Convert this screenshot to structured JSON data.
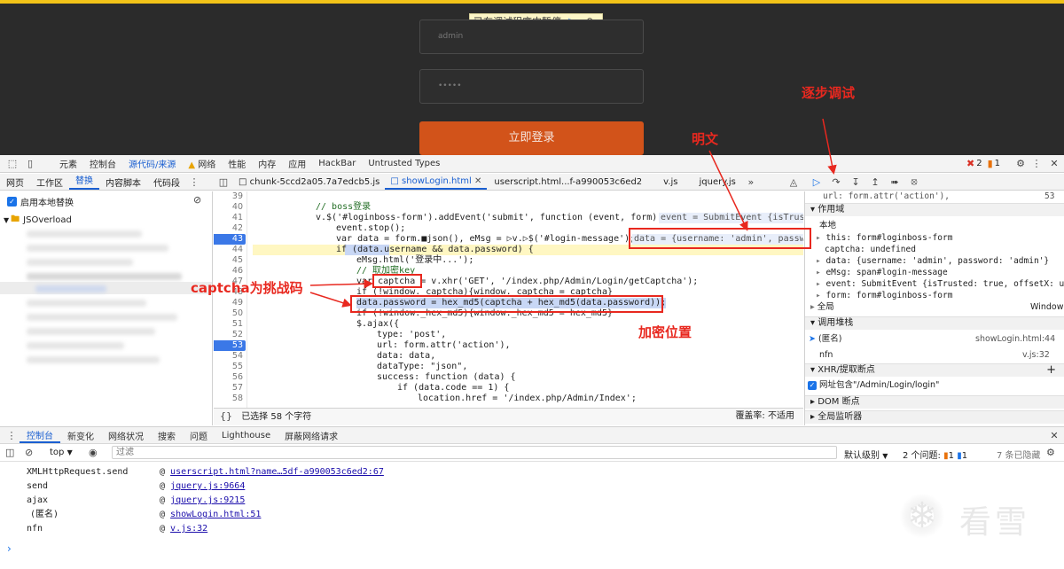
{
  "page": {
    "paused_banner": "已在调试程序中暂停",
    "username_value": "admin",
    "password_value": "•••••",
    "login_button": "立即登录"
  },
  "devtools": {
    "main_tabs": [
      "元素",
      "控制台",
      "源代码/来源",
      "网络",
      "性能",
      "内存",
      "应用",
      "HackBar",
      "Untrusted Types"
    ],
    "errors": "2",
    "warnings": "1",
    "nav_tabs": [
      "网页",
      "工作区",
      "替换",
      "内容脚本",
      "代码段"
    ],
    "file_tabs": [
      "chunk-5ccd2a05.7a7edcb5.js",
      "showLogin.html",
      "userscript.html...f-a990053c6ed2",
      "v.js",
      "jquery.js"
    ],
    "local_override_label": "启用本地替换",
    "folder_name": "JSOverload",
    "status_selected": "已选择 58 个字符",
    "status_coverage": "覆盖率: 不适用",
    "code": {
      "line_numbers": [
        "39",
        "40",
        "41",
        "42",
        "43",
        "44",
        "45",
        "46",
        "47",
        "48",
        "49",
        "50",
        "51",
        "52",
        "53",
        "54",
        "55",
        "56",
        "57",
        "58"
      ],
      "l40": "// boss登录",
      "l41a": "v.$('#loginboss-form').addEvent('submit', function (event, form) {",
      "l41b": "event = SubmitEvent {isTrust",
      "l42": "event.stop();",
      "l43": "var data = form.■json(), eMsg = ▷v.▷$('#login-message');",
      "l43b": "data = {username: 'admin', passwo",
      "l44": "if (data.username && data.password) {",
      "l45": "eMsg.html('登录中...');",
      "l46": "// 取加密key",
      "l47": "var captcha = v.xhr('GET', '/index.php/Admin/Login/getCaptcha');",
      "l48": "if (!window._captcha){window._captcha = captcha}",
      "l49": "data.password = hex_md5(captcha + hex_md5(data.password));",
      "l50": "if (!window._hex_md5){window._hex_md5 = hex_md5}",
      "l51": "$.ajax({",
      "l52": "type: 'post',",
      "l53": "url: form.attr('action'),",
      "l54": "data: data,",
      "l55": "dataType: \"json\",",
      "l56": "success: function (data) {",
      "l57": "if (data.code == 1) {",
      "l58": "location.href = '/index.php/Admin/Index';"
    },
    "right": {
      "top_line": "url: form.attr('action'),",
      "top_line_num": "53",
      "scope_header": "作用域",
      "local_header": "本地",
      "scope_items": [
        "this: form#loginboss-form",
        "captcha: undefined",
        "data: {username: 'admin', password: 'admin'}",
        "eMsg: span#login-message",
        "event: SubmitEvent {isTrusted: true, offsetX: u",
        "form: form#loginboss-form"
      ],
      "global_label": "全局",
      "global_value": "Window",
      "callstack_header": "调用堆栈",
      "callstack": [
        {
          "name": "(匿名)",
          "loc": "showLogin.html:44"
        },
        {
          "name": "nfn",
          "loc": "v.js:32"
        }
      ],
      "xhr_header": "XHR/提取断点",
      "xhr_item": "网址包含\"/Admin/Login/login\"",
      "dom_header": "DOM 断点",
      "global_listeners": "全局监听器"
    },
    "console_tabs": [
      "控制台",
      "新变化",
      "网络状况",
      "搜索",
      "问题",
      "Lighthouse",
      "屏蔽网络请求"
    ],
    "console_bar": {
      "context": "top",
      "filter_placeholder": "过滤",
      "level": "默认级别",
      "issues_label": "2 个问题:",
      "issue_warn": "1",
      "issue_info": "1",
      "hidden": "7 条已隐藏"
    },
    "console_logs": [
      {
        "fn": "XMLHttpRequest.send",
        "src": "userscript.html?name…5df-a990053c6ed2:67"
      },
      {
        "fn": "send",
        "src": "jquery.js:9664"
      },
      {
        "fn": "ajax",
        "src": "jquery.js:9215"
      },
      {
        "fn": "(匿名)",
        "src": "showLogin.html:51"
      },
      {
        "fn": "nfn",
        "src": "v.js:32"
      }
    ]
  },
  "annotations": {
    "step_debug": "逐步调试",
    "plaintext": "明文",
    "captcha_note": "captcha为挑战码",
    "encrypt_pos": "加密位置"
  },
  "watermark": "看雪",
  "colors": {
    "accent": "#1a5fd1",
    "annotation": "#e8281f",
    "login_button": "#d2531a",
    "top_border": "#f2c318"
  }
}
